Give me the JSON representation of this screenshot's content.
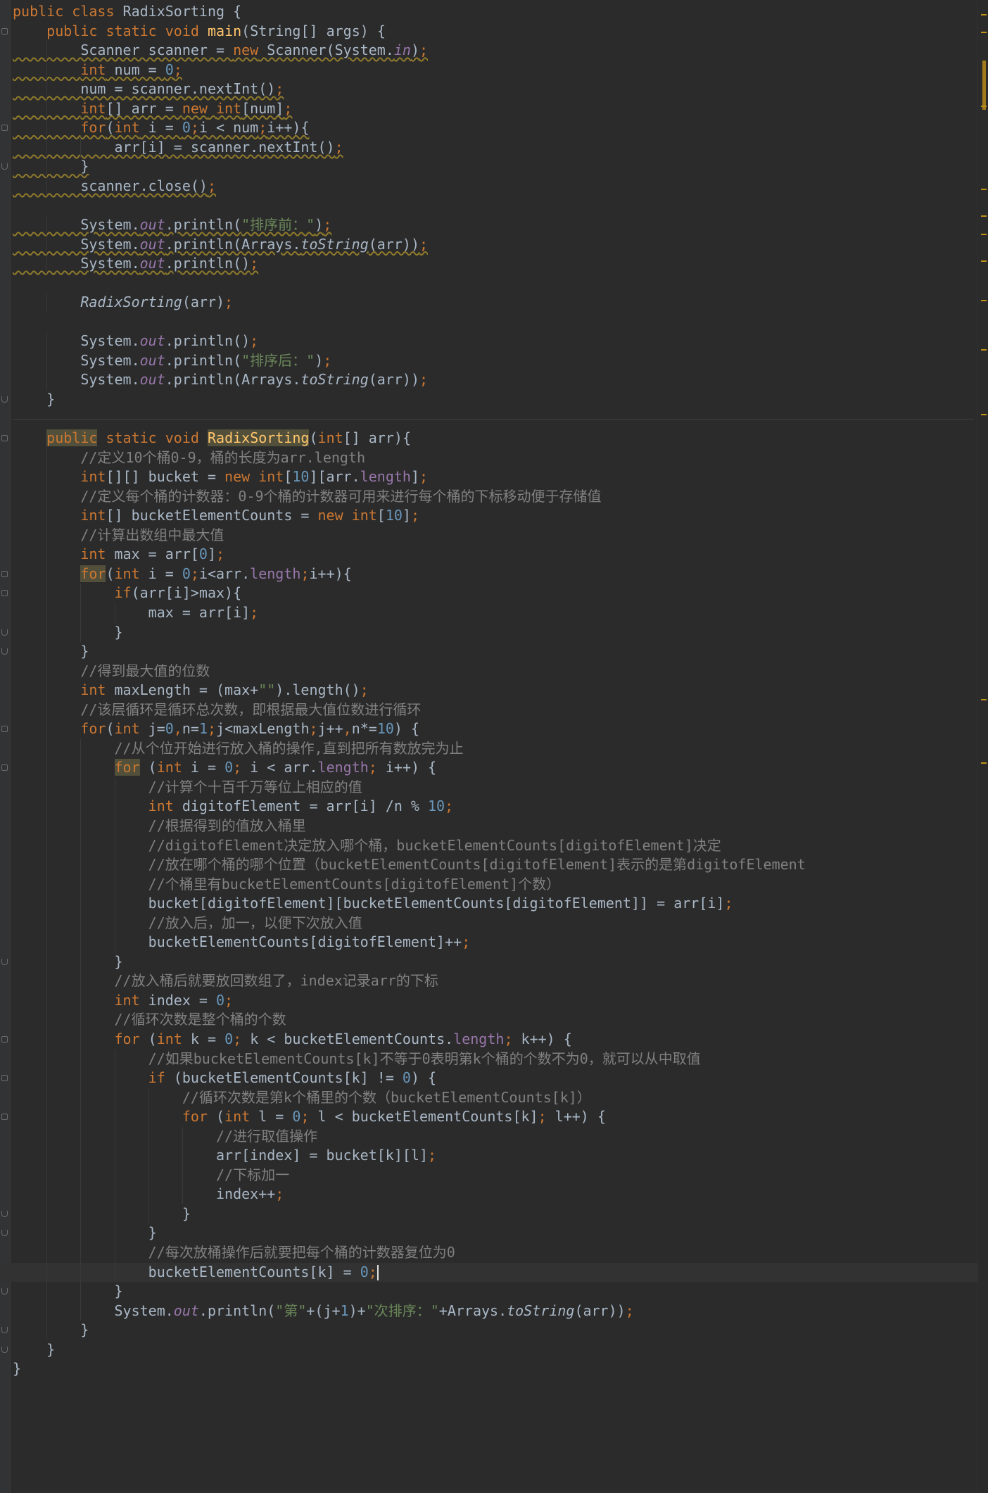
{
  "editor": {
    "language": "Java",
    "class_name": "RadixSorting",
    "cursor_line": 65,
    "lines": [
      "public class RadixSorting {",
      "    public static void main(String[] args) {",
      "        Scanner scanner = new Scanner(System.in);",
      "        int num = 0;",
      "        num = scanner.nextInt();",
      "        int[] arr = new int[num];",
      "        for(int i = 0;i < num;i++){",
      "            arr[i] = scanner.nextInt();",
      "        }",
      "        scanner.close();",
      "",
      "        System.out.println(\"排序前：\");",
      "        System.out.println(Arrays.toString(arr));",
      "        System.out.println();",
      "",
      "        RadixSorting(arr);",
      "",
      "        System.out.println();",
      "        System.out.println(\"排序后：\");",
      "        System.out.println(Arrays.toString(arr));",
      "    }",
      "",
      "    public static void RadixSorting(int[] arr){",
      "        //定义10个桶0-9，桶的长度为arr.length",
      "        int[][] bucket = new int[10][arr.length];",
      "        //定义每个桶的计数器：0-9个桶的计数器可用来进行每个桶的下标移动便于存储值",
      "        int[] bucketElementCounts = new int[10];",
      "        //计算出数组中最大值",
      "        int max = arr[0];",
      "        for(int i = 0;i<arr.length;i++){",
      "            if(arr[i]>max){",
      "                max = arr[i];",
      "            }",
      "        }",
      "        //得到最大值的位数",
      "        int maxLength = (max+\"\").length();",
      "        //该层循环是循环总次数，即根据最大值位数进行循环",
      "        for(int j=0,n=1;j<maxLength;j++,n*=10) {",
      "            //从个位开始进行放入桶的操作,直到把所有数放完为止",
      "            for (int i = 0; i < arr.length; i++) {",
      "                //计算个十百千万等位上相应的值",
      "                int digitofElement = arr[i] /n % 10;",
      "                //根据得到的值放入桶里",
      "                //digitofElement决定放入哪个桶，bucketElementCounts[digitofElement]决定",
      "                //放在哪个桶的哪个位置（bucketElementCounts[digitofElement]表示的是第digitofElement",
      "                //个桶里有bucketElementCounts[digitofElement]个数）",
      "                bucket[digitofElement][bucketElementCounts[digitofElement]] = arr[i];",
      "                //放入后，加一，以便下次放入值",
      "                bucketElementCounts[digitofElement]++;",
      "            }",
      "            //放入桶后就要放回数组了，index记录arr的下标",
      "            int index = 0;",
      "            //循环次数是整个桶的个数",
      "            for (int k = 0; k < bucketElementCounts.length; k++) {",
      "                //如果bucketElementCounts[k]不等于0表明第k个桶的个数不为0，就可以从中取值",
      "                if (bucketElementCounts[k] != 0) {",
      "                    //循环次数是第k个桶里的个数（bucketElementCounts[k]）",
      "                    for (int l = 0; l < bucketElementCounts[k]; l++) {",
      "                        //进行取值操作",
      "                        arr[index] = bucket[k][l];",
      "                        //下标加一",
      "                        index++;",
      "                    }",
      "                }",
      "                //每次放桶操作后就要把每个桶的计数器复位为0",
      "                bucketElementCounts[k] = 0;",
      "            }",
      "            System.out.println(\"第\"+(j+1)+\"次排序：\"+Arrays.toString(arr));",
      "        }",
      "    }",
      "}"
    ]
  },
  "colors": {
    "background": "#2b2b2b",
    "text": "#a9b7c6",
    "keyword": "#cc7832",
    "method_declaration": "#ffc66d",
    "number": "#6897bb",
    "string": "#6a8759",
    "comment": "#808080",
    "field": "#9876aa",
    "highlight": "#52503a",
    "warning_marker": "#be9117"
  }
}
